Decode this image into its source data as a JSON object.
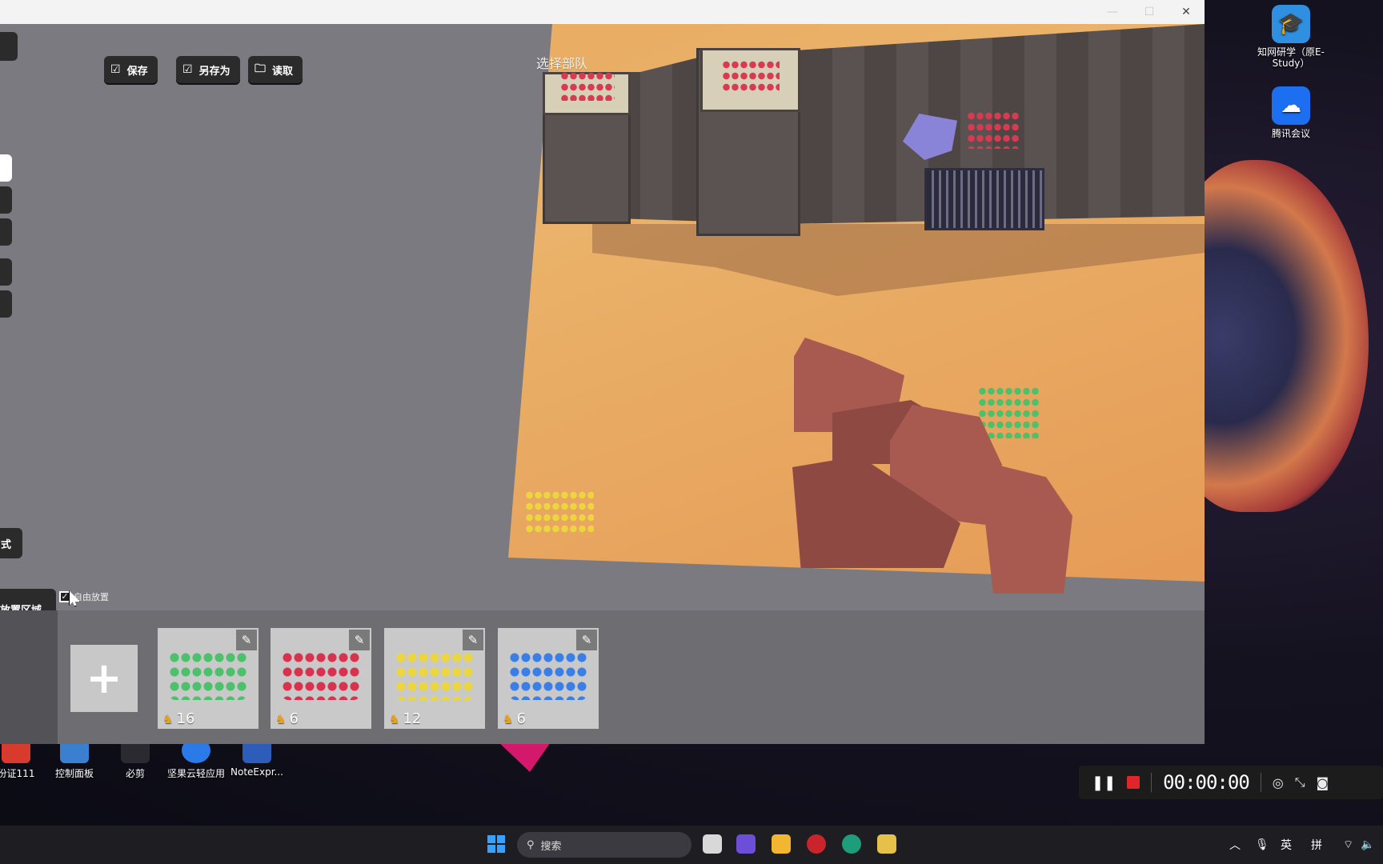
{
  "window": {
    "controls": {
      "minimize": "—",
      "maximize": "☐",
      "close": "✕"
    }
  },
  "toolbar": {
    "save_label": "保存",
    "save_as_label": "另存为",
    "load_label": "读取"
  },
  "viewport": {
    "title": "选择部队",
    "mode_button_label": "式",
    "zone_button_label": "放置区域",
    "free_place_label": "自由放置",
    "free_place_checked": true
  },
  "unit_panel": {
    "add_label": "+",
    "units": [
      {
        "count": "16",
        "color": "#4cc06a",
        "edit_icon": "pencil-icon"
      },
      {
        "count": "6",
        "color": "#d8324e",
        "edit_icon": "pencil-icon"
      },
      {
        "count": "12",
        "color": "#ecd640",
        "edit_icon": "pencil-icon"
      },
      {
        "count": "6",
        "color": "#3a7ee8",
        "edit_icon": "pencil-icon"
      }
    ]
  },
  "desktop": {
    "icons_right": [
      {
        "label": "知网研学（原E-Study）",
        "icon": "zhiwang-icon"
      },
      {
        "label": "腾讯会议",
        "icon": "tencent-meeting-icon"
      }
    ],
    "icons_bottom": [
      {
        "label": "份证111"
      },
      {
        "label": "控制面板"
      },
      {
        "label": "必剪"
      },
      {
        "label": "坚果云轻应用"
      },
      {
        "label": "NoteExpr..."
      }
    ]
  },
  "recorder": {
    "time": "00:00:00",
    "stop_color": "#e0262a"
  },
  "taskbar": {
    "search_placeholder": "搜索",
    "ime_lang": "英",
    "ime_mode": "拼"
  }
}
